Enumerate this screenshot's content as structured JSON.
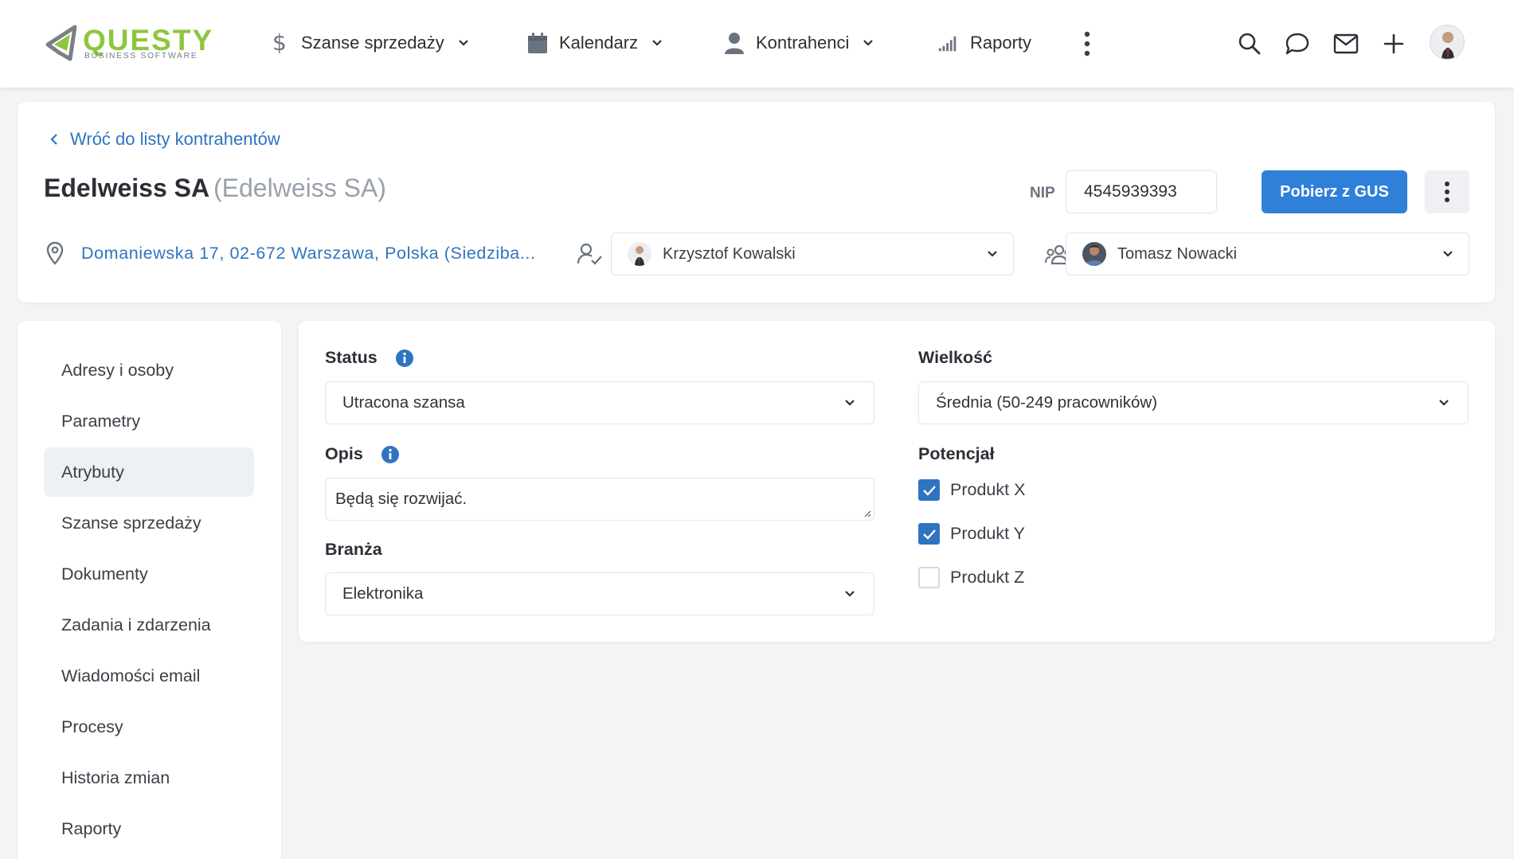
{
  "brand": {
    "name": "QUESTY",
    "tagline": "BUSINESS SOFTWARE",
    "primary_color": "#8dc63f",
    "accent_color": "#2f80d8"
  },
  "nav": {
    "items": [
      {
        "label": "Szanse sprzedaży",
        "icon": "dollar-icon",
        "has_dropdown": true
      },
      {
        "label": "Kalendarz",
        "icon": "calendar-icon",
        "has_dropdown": true
      },
      {
        "label": "Kontrahenci",
        "icon": "person-icon",
        "has_dropdown": true
      },
      {
        "label": "Raporty",
        "icon": "bar-signal-icon",
        "has_dropdown": false
      }
    ],
    "right_icons": [
      "search-icon",
      "chat-icon",
      "mail-icon",
      "plus-icon",
      "user-avatar"
    ]
  },
  "header": {
    "back_link": "Wróć do listy kontrahentów",
    "company_name": "Edelweiss SA",
    "company_alias": "(Edelweiss SA)",
    "nip_label": "NIP",
    "nip_value": "4545939393",
    "gus_button": "Pobierz z GUS",
    "address": "Domaniewska 17, 02-672 Warszawa, Polska (Siedziba...",
    "owner": "Krzysztof Kowalski",
    "team_member": "Tomasz Nowacki"
  },
  "sidebar": {
    "active_index": 2,
    "items": [
      {
        "label": "Adresy i osoby"
      },
      {
        "label": "Parametry"
      },
      {
        "label": "Atrybuty"
      },
      {
        "label": "Szanse sprzedaży"
      },
      {
        "label": "Dokumenty"
      },
      {
        "label": "Zadania i zdarzenia"
      },
      {
        "label": "Wiadomości email"
      },
      {
        "label": "Procesy"
      },
      {
        "label": "Historia zmian"
      },
      {
        "label": "Raporty"
      }
    ]
  },
  "form": {
    "status": {
      "label": "Status",
      "value": "Utracona szansa"
    },
    "description": {
      "label": "Opis",
      "value": "Będą się rozwijać."
    },
    "industry": {
      "label": "Branża",
      "value": "Elektronika"
    },
    "size": {
      "label": "Wielkość",
      "value": "Średnia (50-249 pracowników)"
    },
    "potential": {
      "label": "Potencjał",
      "options": [
        {
          "label": "Produkt X",
          "checked": true
        },
        {
          "label": "Produkt Y",
          "checked": true
        },
        {
          "label": "Produkt Z",
          "checked": false
        }
      ]
    }
  }
}
